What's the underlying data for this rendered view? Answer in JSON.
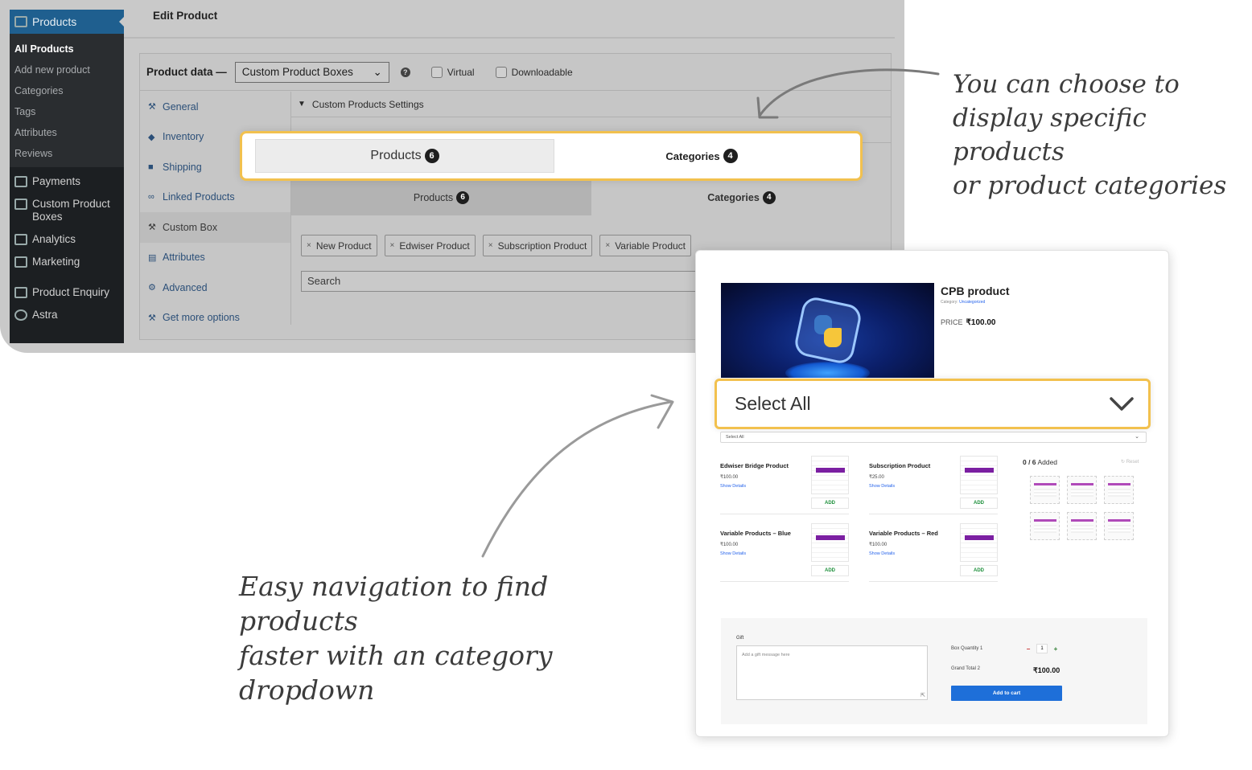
{
  "sidebar": {
    "active_menu": "Products",
    "submenu": [
      "All Products",
      "Add new product",
      "Categories",
      "Tags",
      "Attributes",
      "Reviews"
    ],
    "items": [
      "Payments",
      "Custom Product Boxes",
      "Analytics",
      "Marketing",
      "Product Enquiry",
      "Astra"
    ]
  },
  "page": {
    "title": "Edit Product"
  },
  "product_data": {
    "label": "Product data —",
    "type_value": "Custom Product Boxes",
    "virtual_label": "Virtual",
    "downloadable_label": "Downloadable",
    "tabs": [
      "General",
      "Inventory",
      "Shipping",
      "Linked Products",
      "Custom Box",
      "Attributes",
      "Advanced",
      "Get more options"
    ],
    "section_title": "Custom Products Settings",
    "inner_tabs": {
      "products_label": "Products",
      "products_count": "6",
      "categories_label": "Categories",
      "categories_count": "4"
    },
    "chips": [
      "New Product",
      "Edwiser Product",
      "Subscription Product",
      "Variable Product"
    ],
    "search_placeholder": "Search"
  },
  "highlight_tabs": {
    "products_label": "Products",
    "products_count": "6",
    "categories_label": "Categories",
    "categories_count": "4"
  },
  "notes": {
    "top_right": [
      "You can choose to",
      "display specific products",
      "or product categories"
    ],
    "bottom_left": [
      "Easy navigation to find products",
      "faster with an category dropdown"
    ]
  },
  "frontend": {
    "product_title": "CPB product",
    "category_label": "Category:",
    "category_value": "Uncategorized",
    "price_label": "PRICE",
    "price_value": "₹100.00",
    "select_value": "Select All",
    "small_select_value": "Select All",
    "products": [
      {
        "name": "Edwiser Bridge Product",
        "price": "₹100.00",
        "link": "Show Details",
        "button": "ADD"
      },
      {
        "name": "Subscription Product",
        "price": "₹25.00",
        "link": "Show Details",
        "button": "ADD"
      },
      {
        "name": "Variable Products – Blue",
        "price": "₹100.00",
        "link": "Show Details",
        "button": "ADD"
      },
      {
        "name": "Variable Products – Red",
        "price": "₹100.00",
        "link": "Show Details",
        "button": "ADD"
      }
    ],
    "added_count": "0 / 6",
    "added_label": "Added",
    "reset_label": "Reset",
    "gift_label": "Gift",
    "gift_placeholder": "Add a gift message here",
    "box_quantity_label": "Box Quantity 1",
    "quantity_value": "1",
    "grand_total_label": "Grand Total 2",
    "grand_total_value": "₹100.00",
    "add_to_cart_label": "Add to cart"
  },
  "colors": {
    "highlight_border": "#f2c14e",
    "wp_active": "#1f5f8f",
    "button_blue": "#1e6fd9",
    "add_green": "#1c8f3a"
  }
}
